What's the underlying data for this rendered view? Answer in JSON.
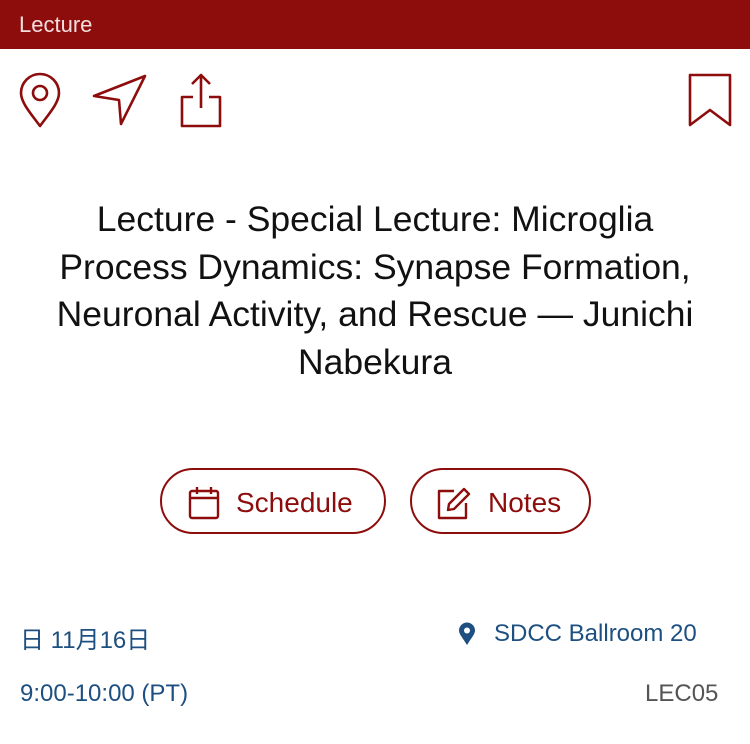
{
  "header": {
    "category_label": "Lecture"
  },
  "toolbar": {
    "icons": [
      "map-pin-icon",
      "send-icon",
      "share-icon",
      "bookmark-icon"
    ]
  },
  "session": {
    "title": "Lecture - Special Lecture: Microglia Process Dynamics: Synapse Formation, Neuronal Activity, and Rescue — Junichi Nabekura",
    "date": "日 11月16日",
    "time": "9:00-10:00 (PT)",
    "location": "SDCC Ballroom 20",
    "code": "LEC05"
  },
  "actions": {
    "schedule_label": "Schedule",
    "notes_label": "Notes"
  },
  "colors": {
    "brand": "#8d0d0d",
    "info_text": "#1d4f80"
  }
}
